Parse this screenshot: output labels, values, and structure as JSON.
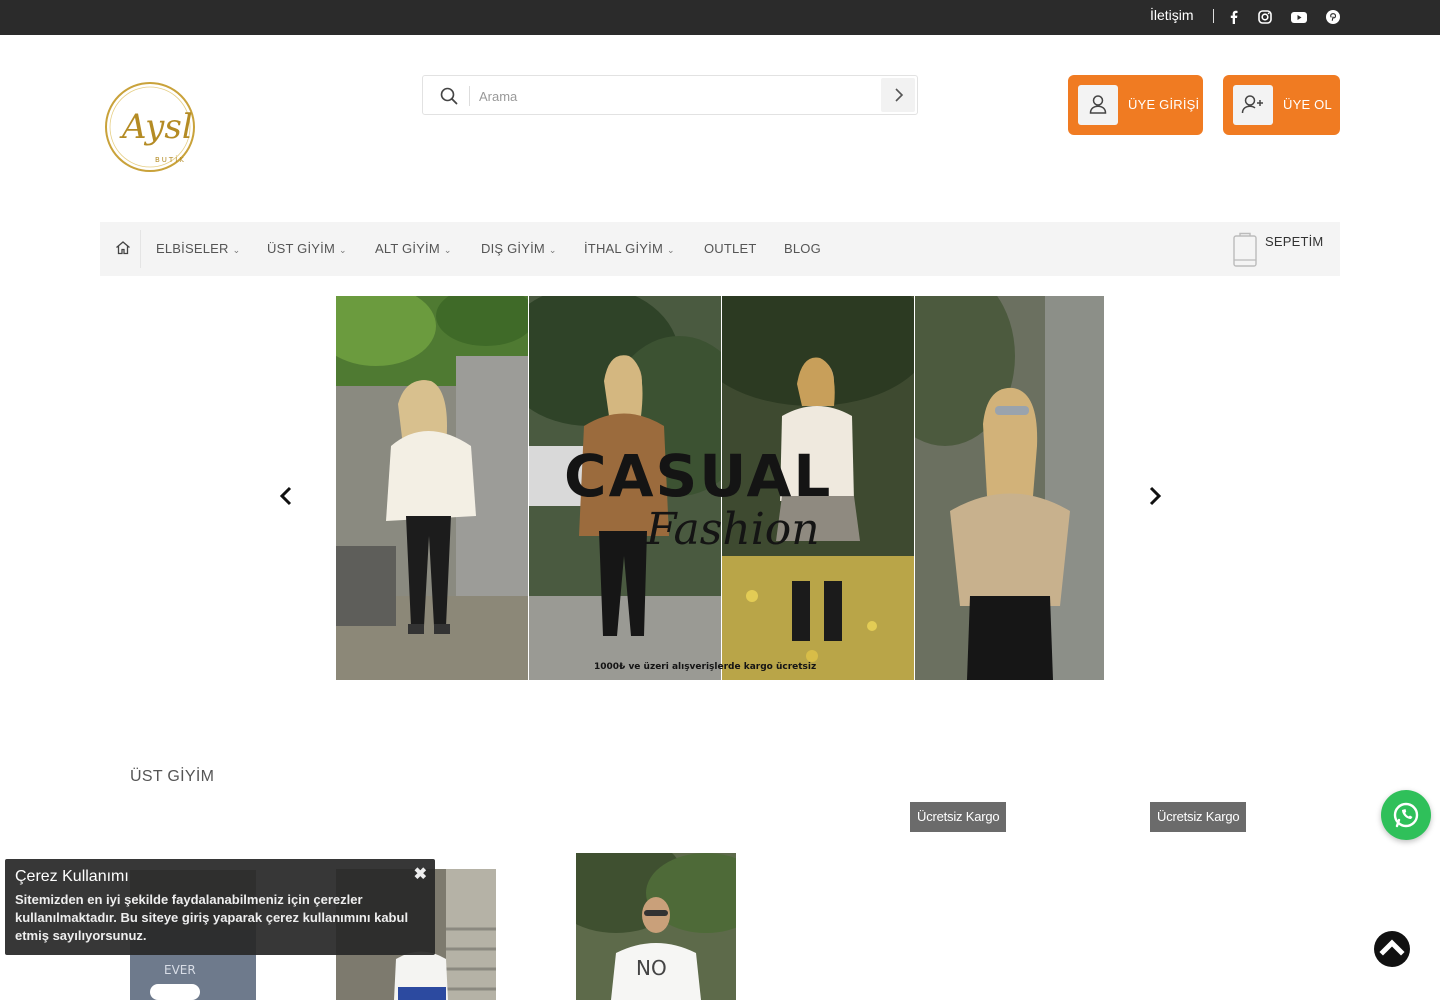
{
  "topbar": {
    "contact_label": "İletişim",
    "social": [
      {
        "name": "facebook",
        "glyph": "f"
      },
      {
        "name": "instagram",
        "glyph": "◎"
      },
      {
        "name": "youtube",
        "glyph": "▶"
      },
      {
        "name": "pinterest",
        "glyph": "p"
      }
    ]
  },
  "logo": {
    "brand_lettering": "Aysl",
    "sub_lettering": "BUTİK"
  },
  "search": {
    "placeholder": "Arama",
    "value": ""
  },
  "account": {
    "login_label": "ÜYE GİRİŞİ",
    "register_label": "ÜYE OL"
  },
  "nav": {
    "items": [
      {
        "label": "ELBİSELER",
        "has_dropdown": true
      },
      {
        "label": "ÜST GİYİM",
        "has_dropdown": true
      },
      {
        "label": "ALT GİYİM",
        "has_dropdown": true
      },
      {
        "label": "DIŞ GİYİM",
        "has_dropdown": true
      },
      {
        "label": "İTHAL GİYİM",
        "has_dropdown": true
      },
      {
        "label": "OUTLET",
        "has_dropdown": false
      },
      {
        "label": "BLOG",
        "has_dropdown": false
      }
    ],
    "cart_label": "SEPETİM"
  },
  "hero": {
    "overlay_title": "CASUAL",
    "overlay_script": "Fashion",
    "overlay_footer": "1000₺ ve üzeri alışverişlerde kargo ücretsiz"
  },
  "section": {
    "title": "ÜST GİYİM"
  },
  "badges": [
    "Ücretsiz Kargo",
    "Ücretsiz Kargo"
  ],
  "products": [
    {
      "shirt_print": "EVER"
    },
    {
      "shirt_print": ""
    },
    {
      "shirt_print": "NO"
    }
  ],
  "cookie": {
    "title": "Çerez Kullanımı",
    "text": "Sitemizden en iyi şekilde faydalanabilmeniz için çerezler kullanılmaktadır. Bu siteye giriş yaparak çerez kullanımını kabul etmiş sayılıyorsunuz.",
    "close_glyph": "✖"
  },
  "colors": {
    "accent": "#f07b22",
    "topbar": "#2b2b2b",
    "whatsapp": "#2fc05a"
  }
}
